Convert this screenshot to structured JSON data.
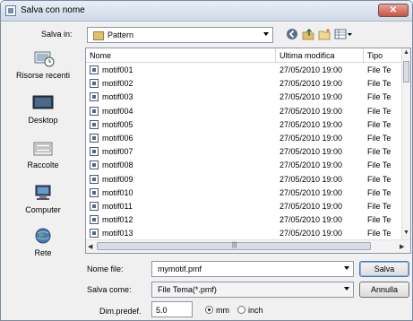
{
  "window": {
    "title": "Salva con nome",
    "close_label": "✕"
  },
  "save_in": {
    "label": "Salva in:",
    "value": "Pattern"
  },
  "toolbar": {
    "icons": [
      "back-icon",
      "up-folder-icon",
      "new-folder-icon",
      "view-menu-icon"
    ]
  },
  "places": [
    {
      "label": "Risorse recenti",
      "icon": "recent-places-icon"
    },
    {
      "label": "Desktop",
      "icon": "desktop-icon"
    },
    {
      "label": "Raccolte",
      "icon": "libraries-icon"
    },
    {
      "label": "Computer",
      "icon": "computer-icon"
    },
    {
      "label": "Rete",
      "icon": "network-icon"
    }
  ],
  "columns": {
    "name": "Nome",
    "modified": "Ultima modifica",
    "type": "Tipo"
  },
  "files": [
    {
      "name": "motif001",
      "modified": "27/05/2010 19:00",
      "type": "File Te"
    },
    {
      "name": "motif002",
      "modified": "27/05/2010 19:00",
      "type": "File Te"
    },
    {
      "name": "motif003",
      "modified": "27/05/2010 19:00",
      "type": "File Te"
    },
    {
      "name": "motif004",
      "modified": "27/05/2010 19:00",
      "type": "File Te"
    },
    {
      "name": "motif005",
      "modified": "27/05/2010 19:00",
      "type": "File Te"
    },
    {
      "name": "motif006",
      "modified": "27/05/2010 19:00",
      "type": "File Te"
    },
    {
      "name": "motif007",
      "modified": "27/05/2010 19:00",
      "type": "File Te"
    },
    {
      "name": "motif008",
      "modified": "27/05/2010 19:00",
      "type": "File Te"
    },
    {
      "name": "motif009",
      "modified": "27/05/2010 19:00",
      "type": "File Te"
    },
    {
      "name": "motif010",
      "modified": "27/05/2010 19:00",
      "type": "File Te"
    },
    {
      "name": "motif011",
      "modified": "27/05/2010 19:00",
      "type": "File Te"
    },
    {
      "name": "motif012",
      "modified": "27/05/2010 19:00",
      "type": "File Te"
    },
    {
      "name": "motif013",
      "modified": "27/05/2010 19:00",
      "type": "File Te"
    }
  ],
  "filename": {
    "label": "Nome file:",
    "value": "mymotif.pmf"
  },
  "savetype": {
    "label": "Salva come:",
    "value": "File Tema(*.pmf)"
  },
  "buttons": {
    "save": "Salva",
    "cancel": "Annulla"
  },
  "size": {
    "label": "Dim.predef.",
    "value": "5.0",
    "units": [
      {
        "label": "mm",
        "selected": true
      },
      {
        "label": "inch",
        "selected": false
      }
    ]
  }
}
